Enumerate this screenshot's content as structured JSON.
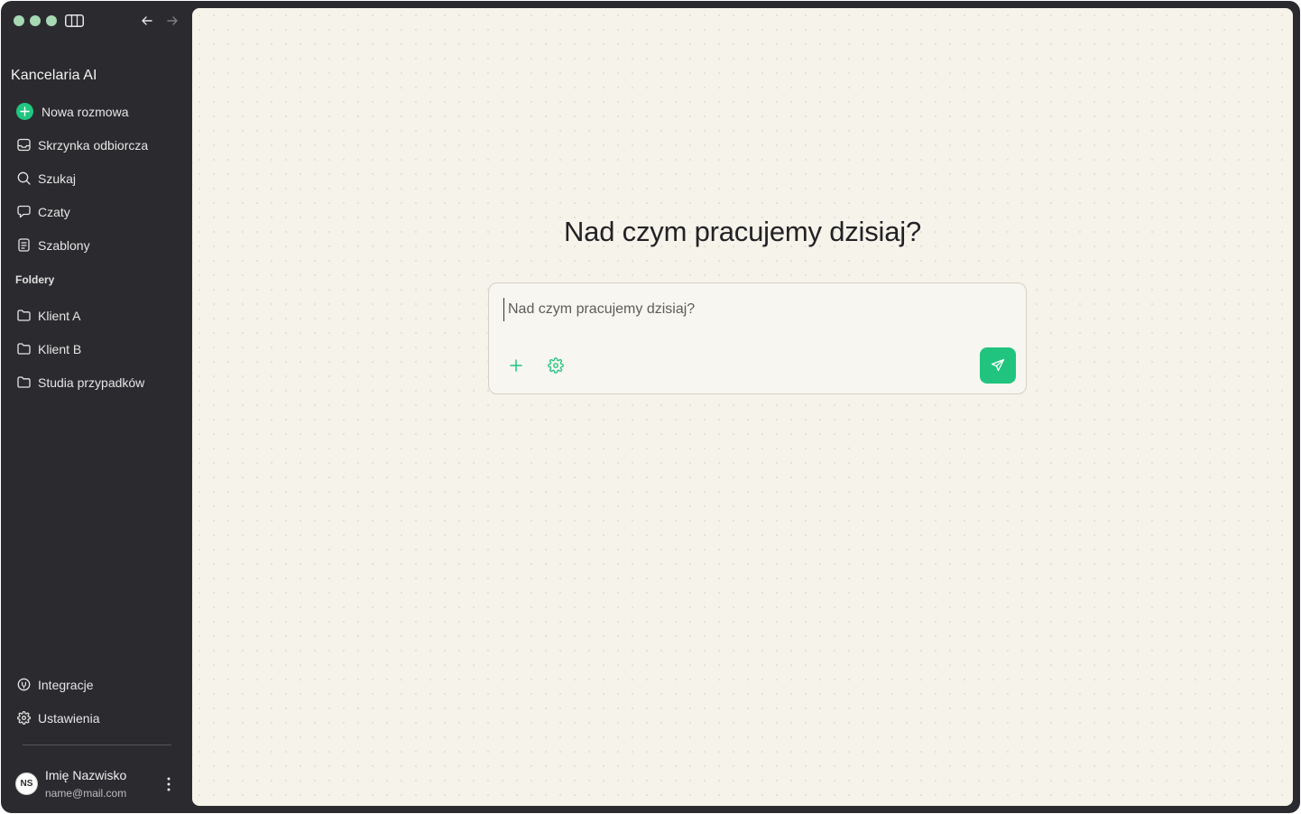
{
  "app": {
    "title": "Kancelaria AI"
  },
  "sidebar": {
    "new_chat": {
      "label": "Nowa rozmowa",
      "icon": "plus-icon"
    },
    "items": [
      {
        "label": "Skrzynka odbiorcza",
        "icon": "inbox-icon"
      },
      {
        "label": "Szukaj",
        "icon": "search-icon"
      },
      {
        "label": "Czaty",
        "icon": "chat-icon"
      },
      {
        "label": "Szablony",
        "icon": "template-icon"
      }
    ],
    "folders_label": "Foldery",
    "folders": [
      {
        "label": "Klient A",
        "icon": "folder-icon"
      },
      {
        "label": "Klient B",
        "icon": "folder-icon"
      },
      {
        "label": "Studia przypadków",
        "icon": "folder-icon"
      }
    ],
    "bottom": [
      {
        "label": "Integracje",
        "icon": "integration-icon"
      },
      {
        "label": "Ustawienia",
        "icon": "gear-icon"
      }
    ],
    "user": {
      "initials": "NS",
      "name": "Imię Nazwisko",
      "email": "name@mail.com"
    }
  },
  "main": {
    "heading": "Nad czym pracujemy dzisiaj?",
    "composer": {
      "placeholder": "Nad czym pracujemy dzisiaj?",
      "value": ""
    }
  },
  "colors": {
    "accent": "#21c47f",
    "sidebar_bg": "#2b2b2f",
    "main_bg": "#f6f3ea"
  }
}
